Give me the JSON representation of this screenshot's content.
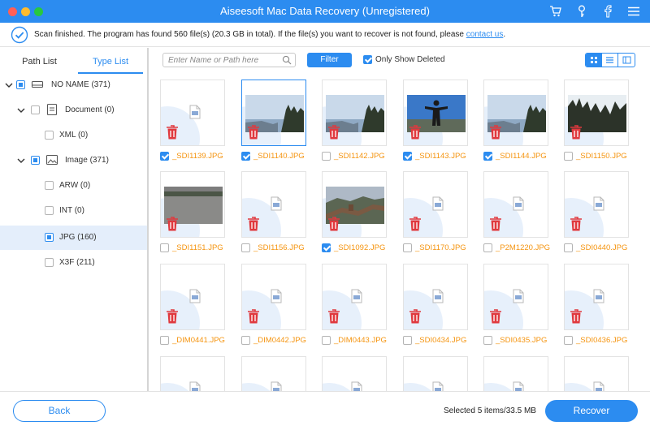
{
  "window": {
    "title": "Aiseesoft Mac Data Recovery (Unregistered)",
    "toolbar_icons": [
      "cart-icon",
      "key-icon",
      "facebook-icon",
      "menu-icon"
    ]
  },
  "status": {
    "message": "Scan finished. The program has found 560 file(s) (20.3 GB in total). If the file(s) you want to recover is not found, please ",
    "link": "contact us",
    "trail": "."
  },
  "sidebar": {
    "tabs": [
      {
        "label": "Path List",
        "active": false
      },
      {
        "label": "Type List",
        "active": true
      }
    ],
    "tree": [
      {
        "label": "NO NAME (371)",
        "icon": "drive-icon",
        "expanded": true,
        "check": "partial"
      },
      {
        "label": "Document (0)",
        "icon": "document-icon",
        "expanded": true,
        "check": "none"
      },
      {
        "label": "XML (0)",
        "check": "none"
      },
      {
        "label": "Image (371)",
        "icon": "image-icon",
        "expanded": true,
        "check": "partial"
      },
      {
        "label": "ARW (0)",
        "check": "none"
      },
      {
        "label": "INT (0)",
        "check": "none"
      },
      {
        "label": "JPG (160)",
        "check": "partial",
        "selected": true
      },
      {
        "label": "X3F (211)",
        "check": "none"
      }
    ]
  },
  "toolbar": {
    "search_placeholder": "Enter Name or Path here",
    "filter_label": "Filter",
    "only_show_deleted": "Only Show Deleted",
    "only_show_deleted_checked": true,
    "views": [
      "grid-view-icon",
      "list-view-icon",
      "detail-view-icon"
    ],
    "active_view": "grid-view-icon"
  },
  "files": [
    {
      "name": "_SDI1139.JPG",
      "checked": true,
      "thumb": "none"
    },
    {
      "name": "_SDI1140.JPG",
      "checked": true,
      "thumb": "coast",
      "selected": true
    },
    {
      "name": "_SDI1142.JPG",
      "checked": false,
      "thumb": "coast"
    },
    {
      "name": "_SDI1143.JPG",
      "checked": true,
      "thumb": "person"
    },
    {
      "name": "_SDI1144.JPG",
      "checked": true,
      "thumb": "coast"
    },
    {
      "name": "_SDI1150.JPG",
      "checked": false,
      "thumb": "forest"
    },
    {
      "name": "_SDI1151.JPG",
      "checked": false,
      "thumb": "gray"
    },
    {
      "name": "_SDI1156.JPG",
      "checked": false,
      "thumb": "none"
    },
    {
      "name": "_SDI1092.JPG",
      "checked": true,
      "thumb": "wall"
    },
    {
      "name": "_SDI1170.JPG",
      "checked": false,
      "thumb": "none"
    },
    {
      "name": "_P2M1220.JPG",
      "checked": false,
      "thumb": "none"
    },
    {
      "name": "_SDI0440.JPG",
      "checked": false,
      "thumb": "none"
    },
    {
      "name": "_DIM0441.JPG",
      "checked": false,
      "thumb": "none"
    },
    {
      "name": "_DIM0442.JPG",
      "checked": false,
      "thumb": "none"
    },
    {
      "name": "_DIM0443.JPG",
      "checked": false,
      "thumb": "none"
    },
    {
      "name": "_SDI0434.JPG",
      "checked": false,
      "thumb": "none"
    },
    {
      "name": "_SDI0435.JPG",
      "checked": false,
      "thumb": "none"
    },
    {
      "name": "_SDI0436.JPG",
      "checked": false,
      "thumb": "none"
    },
    {
      "name": "",
      "checked": false,
      "thumb": "none"
    },
    {
      "name": "",
      "checked": false,
      "thumb": "none"
    },
    {
      "name": "",
      "checked": false,
      "thumb": "none"
    },
    {
      "name": "",
      "checked": false,
      "thumb": "none"
    },
    {
      "name": "",
      "checked": false,
      "thumb": "none"
    },
    {
      "name": "",
      "checked": false,
      "thumb": "none"
    }
  ],
  "footer": {
    "back_label": "Back",
    "selected_info": "Selected 5 items/33.5 MB",
    "recover_label": "Recover"
  },
  "colors": {
    "accent": "#2c8cf0",
    "file_name": "#f5940f",
    "trash": "#e0393e"
  }
}
